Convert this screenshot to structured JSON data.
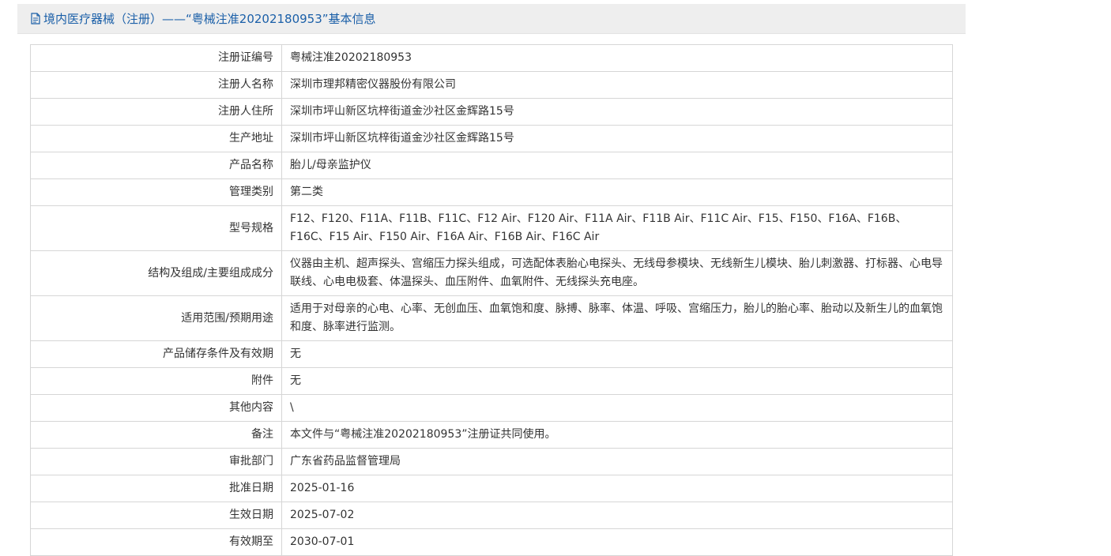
{
  "header": {
    "title": "境内医疗器械（注册）——“粤械注准20202180953”基本信息"
  },
  "rows": [
    {
      "label": "注册证编号",
      "value": "粤械注准20202180953"
    },
    {
      "label": "注册人名称",
      "value": "深圳市理邦精密仪器股份有限公司"
    },
    {
      "label": "注册人住所",
      "value": "深圳市坪山新区坑梓街道金沙社区金辉路15号"
    },
    {
      "label": "生产地址",
      "value": "深圳市坪山新区坑梓街道金沙社区金辉路15号"
    },
    {
      "label": "产品名称",
      "value": "胎儿/母亲监护仪"
    },
    {
      "label": "管理类别",
      "value": "第二类"
    },
    {
      "label": "型号规格",
      "value": "F12、F120、F11A、F11B、F11C、F12 Air、F120 Air、F11A Air、F11B Air、F11C Air、F15、F150、F16A、F16B、F16C、F15 Air、F150 Air、F16A Air、F16B Air、F16C Air"
    },
    {
      "label": "结构及组成/主要组成成分",
      "value": "仪器由主机、超声探头、宫缩压力探头组成，可选配体表胎心电探头、无线母参模块、无线新生儿模块、胎儿刺激器、打标器、心电导联线、心电电极套、体温探头、血压附件、血氧附件、无线探头充电座。"
    },
    {
      "label": "适用范围/预期用途",
      "value": "适用于对母亲的心电、心率、无创血压、血氧饱和度、脉搏、脉率、体温、呼吸、宫缩压力，胎儿的胎心率、胎动以及新生儿的血氧饱和度、脉率进行监测。"
    },
    {
      "label": "产品储存条件及有效期",
      "value": "无"
    },
    {
      "label": "附件",
      "value": "无"
    },
    {
      "label": "其他内容",
      "value": "\\"
    },
    {
      "label": "备注",
      "value": "本文件与“粤械注准20202180953”注册证共同使用。"
    },
    {
      "label": "审批部门",
      "value": "广东省药品监督管理局"
    },
    {
      "label": "批准日期",
      "value": "2025-01-16"
    },
    {
      "label": "生效日期",
      "value": "2025-07-02"
    },
    {
      "label": "有效期至",
      "value": "2030-07-01"
    }
  ],
  "colors": {
    "header_bg": "#eeeeee",
    "header_text": "#1a5fa8",
    "border": "#d6d6d6"
  },
  "icons": {
    "header_icon": "document-icon"
  }
}
